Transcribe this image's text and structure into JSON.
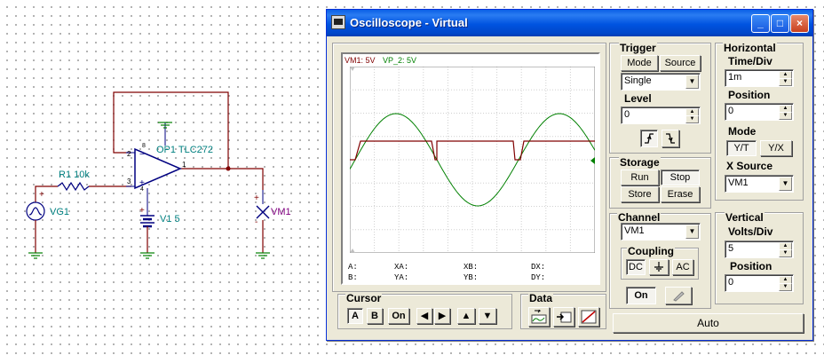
{
  "schematic": {
    "opamp_label": "OP1 TLC272",
    "resistor_label": "R1 10k",
    "generator_label": "VG1",
    "battery_label": "V1 5",
    "voltmeter_label": "VM1",
    "pin_labels": [
      "2",
      "3",
      "1",
      "4",
      "8"
    ]
  },
  "window": {
    "title": "Oscilloscope - Virtual",
    "controls": [
      "_",
      "□",
      "×"
    ]
  },
  "screen": {
    "legend": [
      {
        "name": "VM1: 5V",
        "color": "#800000"
      },
      {
        "name": "VP_2: 5V",
        "color": "#008000"
      }
    ],
    "readouts": {
      "A": "A:",
      "B": "B:",
      "XA": "XA:",
      "YA": "YA:",
      "XB": "XB:",
      "YB": "YB:",
      "DX": "DX:",
      "DY": "DY:"
    }
  },
  "trigger": {
    "title": "Trigger",
    "mode_button": "Mode",
    "source_button": "Source",
    "mode_value": "Single",
    "level_label": "Level",
    "level_value": "0"
  },
  "horizontal": {
    "title": "Horizontal",
    "time_div_label": "Time/Div",
    "time_div_value": "1m",
    "position_label": "Position",
    "position_value": "0",
    "mode_label": "Mode",
    "mode_yt": "Y/T",
    "mode_yx": "Y/X",
    "x_source_label": "X Source",
    "x_source_value": "VM1"
  },
  "storage": {
    "title": "Storage",
    "run": "Run",
    "stop": "Stop",
    "store": "Store",
    "erase": "Erase"
  },
  "channel": {
    "title": "Channel",
    "value": "VM1",
    "coupling_title": "Coupling",
    "dc": "DC",
    "ac": "AC",
    "on": "On"
  },
  "vertical": {
    "title": "Vertical",
    "volts_div_label": "Volts/Div",
    "volts_div_value": "5",
    "position_label": "Position",
    "position_value": "0"
  },
  "cursor": {
    "title": "Cursor",
    "a": "A",
    "b": "B",
    "on": "On"
  },
  "data": {
    "title": "Data"
  },
  "auto_button": "Auto",
  "colors": {
    "titlebar": "#0053e0",
    "trace_vm1": "#800000",
    "trace_vp2": "#008000",
    "wire": "#800000",
    "component": "#000080"
  }
}
